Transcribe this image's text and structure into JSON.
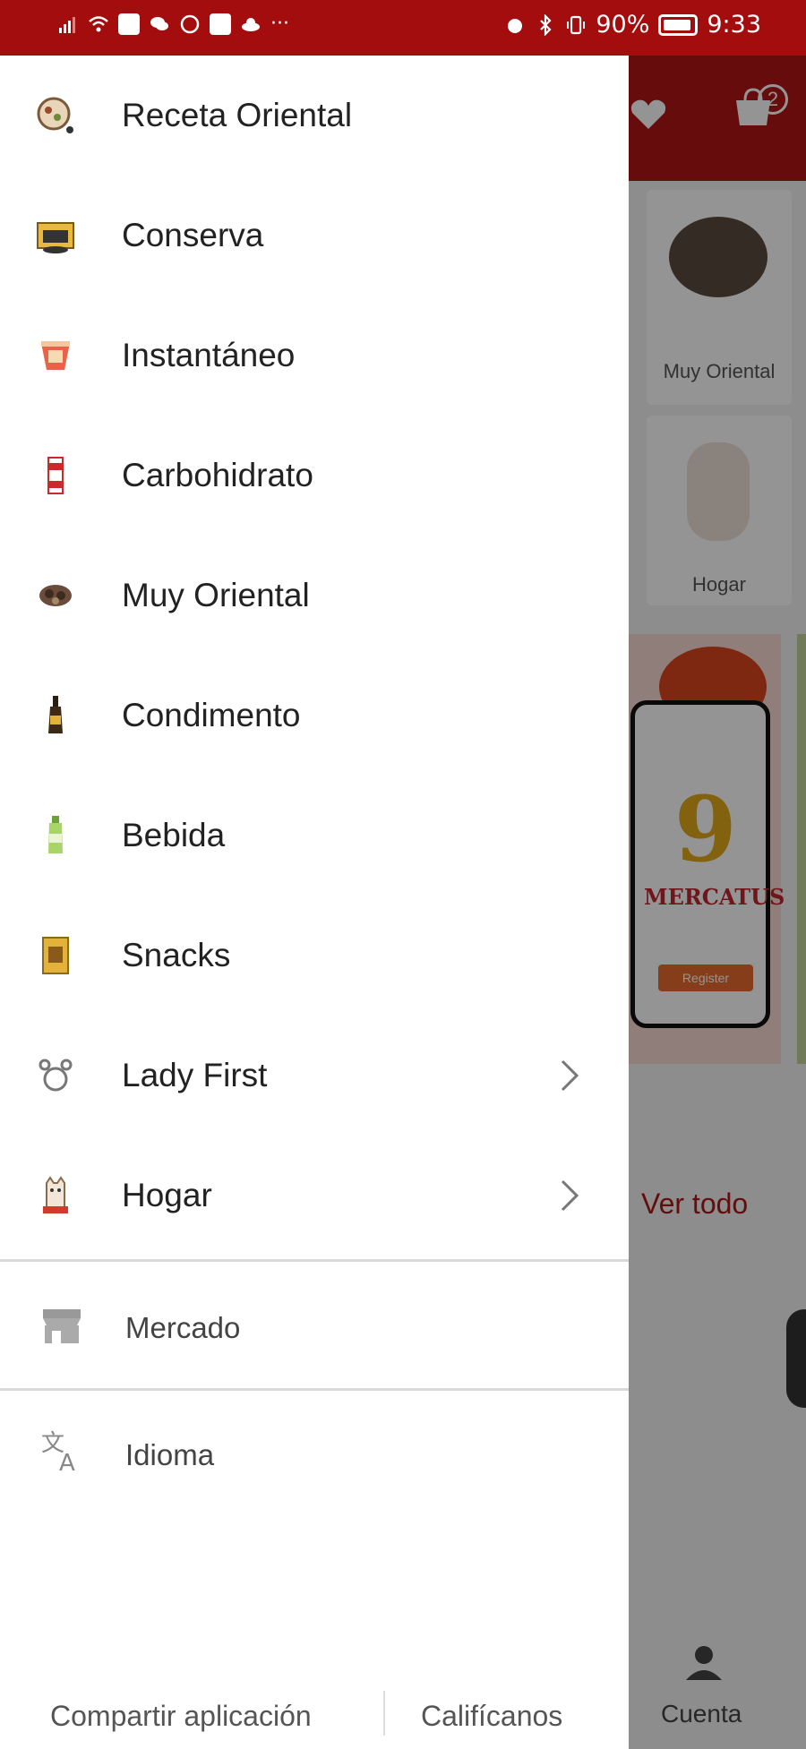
{
  "status_bar": {
    "battery": "90%",
    "time": "9:33"
  },
  "drawer": {
    "categories": [
      {
        "label": "Receta Oriental",
        "icon": "recipe-plate-icon",
        "chevron": false
      },
      {
        "label": "Conserva",
        "icon": "canned-food-icon",
        "chevron": false
      },
      {
        "label": "Instantáneo",
        "icon": "instant-noodle-cup-icon",
        "chevron": false
      },
      {
        "label": "Carbohidrato",
        "icon": "carbohydrate-bag-icon",
        "chevron": false
      },
      {
        "label": "Muy Oriental",
        "icon": "mushroom-icon",
        "chevron": false
      },
      {
        "label": "Condimento",
        "icon": "sauce-bottle-icon",
        "chevron": false
      },
      {
        "label": "Bebida",
        "icon": "drink-bottle-icon",
        "chevron": false
      },
      {
        "label": "Snacks",
        "icon": "snack-pack-icon",
        "chevron": false
      },
      {
        "label": "Lady First",
        "icon": "lady-bow-icon",
        "chevron": true
      },
      {
        "label": "Hogar",
        "icon": "lucky-cat-icon",
        "chevron": true
      }
    ],
    "mercado": {
      "label": "Mercado",
      "icon": "store-icon"
    },
    "idioma": {
      "label": "Idioma",
      "icon": "translate-icon"
    },
    "footer": {
      "share_label": "Compartir aplicación",
      "rate_label": "Califícanos"
    }
  },
  "background_app": {
    "cart_count": "2",
    "cards": [
      {
        "label": "Muy Oriental"
      },
      {
        "label": "Hogar"
      }
    ],
    "banner": {
      "number": "9",
      "brand": "MERCATUS",
      "button": "Register"
    },
    "see_all_label": "Ver todo",
    "nav_account_label": "Cuenta"
  },
  "colors": {
    "brand_red": "#a30d0d",
    "accent_red": "#b01616"
  }
}
